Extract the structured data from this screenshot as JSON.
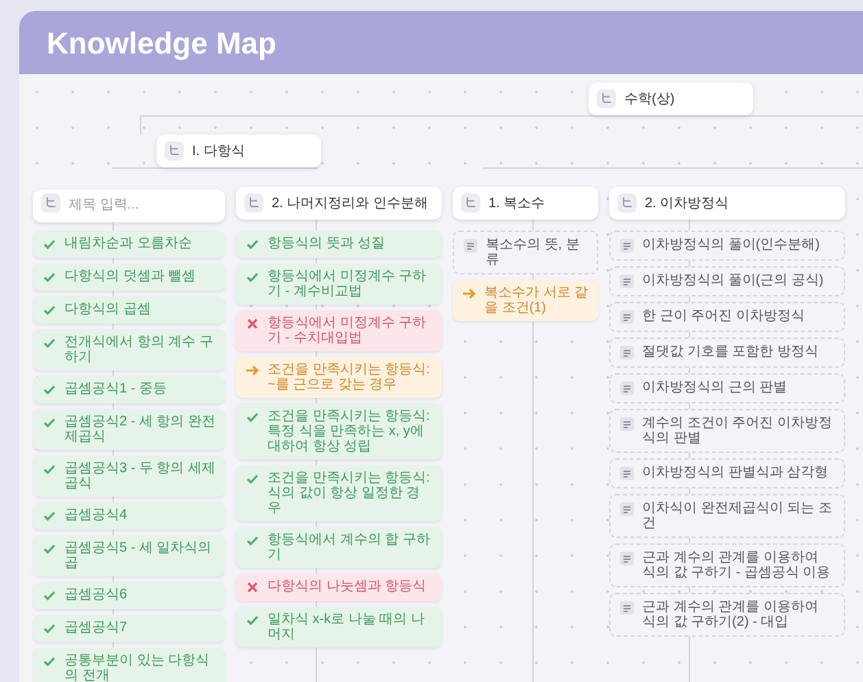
{
  "header": {
    "title": "Knowledge Map"
  },
  "root": {
    "label": "수학(상)"
  },
  "branches": [
    {
      "label": "I. 다항식"
    }
  ],
  "topics": [
    {
      "placeholder": "제목 입력...",
      "items": [
        {
          "label": "내림차순과 오름차순",
          "kind": "done"
        },
        {
          "label": "다항식의 덧셈과 뺄셈",
          "kind": "done"
        },
        {
          "label": "다항식의 곱셈",
          "kind": "done"
        },
        {
          "label": "전개식에서 항의 계수 구하기",
          "kind": "done"
        },
        {
          "label": "곱셈공식1 - 중등",
          "kind": "done"
        },
        {
          "label": "곱셈공식2 - 세 항의 완전제곱식",
          "kind": "done"
        },
        {
          "label": "곱셈공식3 - 두 항의 세제곱식",
          "kind": "done"
        },
        {
          "label": "곱셈공식4",
          "kind": "done"
        },
        {
          "label": "곱셈공식5 - 세 일차식의 곱",
          "kind": "done"
        },
        {
          "label": "곱셈공식6",
          "kind": "done"
        },
        {
          "label": "곱셈공식7",
          "kind": "done"
        },
        {
          "label": "공통부분이 있는 다항식의 전개",
          "kind": "done"
        }
      ]
    },
    {
      "label": "2. 나머지정리와 인수분해",
      "items": [
        {
          "label": "항등식의 뜻과 성질",
          "kind": "done"
        },
        {
          "label": "항등식에서 미정계수 구하기 - 계수비교법",
          "kind": "done"
        },
        {
          "label": "항등식에서 미정계수 구하기 - 수치대입법",
          "kind": "wrong"
        },
        {
          "label": "조건을 만족시키는 항등식: ~를 근으로 갖는 경우",
          "kind": "next"
        },
        {
          "label": "조건을 만족시키는 항등식: 특정 식을 만족하는 x, y에 대하여 항상 성립",
          "kind": "done"
        },
        {
          "label": "조건을 만족시키는 항등식: 식의 값이 항상 일정한 경우",
          "kind": "done"
        },
        {
          "label": "항등식에서 계수의 합 구하기",
          "kind": "done"
        },
        {
          "label": "다항식의 나눗셈과 항등식",
          "kind": "wrong"
        },
        {
          "label": "일차식 x-k로 나눌 때의 나머지",
          "kind": "done"
        }
      ]
    },
    {
      "label": "1. 복소수",
      "items": [
        {
          "label": "복소수의 뜻, 분류",
          "kind": "todo"
        },
        {
          "label": "복소수가 서로 같을 조건(1)",
          "kind": "next"
        }
      ]
    },
    {
      "label": "2. 이차방정식",
      "items": [
        {
          "label": "이차방정식의 풀이(인수분해)",
          "kind": "todo"
        },
        {
          "label": "이차방정식의 풀이(근의 공식)",
          "kind": "todo"
        },
        {
          "label": "한 근이 주어진 이차방정식",
          "kind": "todo"
        },
        {
          "label": "절댓값 기호를 포함한 방정식",
          "kind": "todo"
        },
        {
          "label": "이차방정식의 근의 판별",
          "kind": "todo"
        },
        {
          "label": "계수의 조건이 주어진 이차방정식의 판별",
          "kind": "todo"
        },
        {
          "label": "이차방정식의 판별식과 삼각형",
          "kind": "todo"
        },
        {
          "label": "이차식이 완전제곱식이 되는 조건",
          "kind": "todo"
        },
        {
          "label": "근과 계수의 관계를 이용하여 식의 값 구하기 - 곱셈공식 이용",
          "kind": "todo"
        },
        {
          "label": "근과 계수의 관계를 이용하여 식의 값 구하기(2) - 대입",
          "kind": "todo"
        }
      ]
    }
  ]
}
